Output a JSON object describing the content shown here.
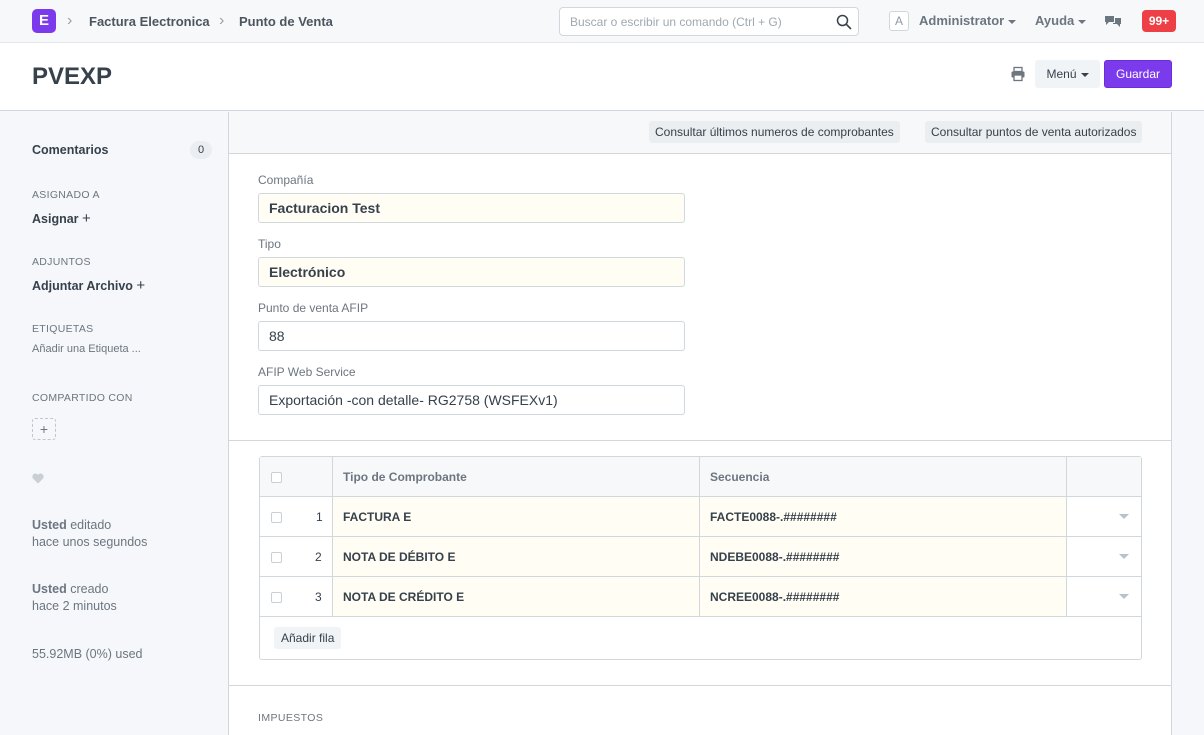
{
  "navbar": {
    "logo_letter": "E",
    "breadcrumbs": [
      "Factura Electronica",
      "Punto de Venta"
    ],
    "search_placeholder": "Buscar o escribir un comando (Ctrl + G)",
    "avatar_letter": "A",
    "user_menu": "Administrator",
    "help_menu": "Ayuda",
    "notifications": "99+"
  },
  "page": {
    "title": "PVEXP",
    "menu_label": "Menú",
    "save_label": "Guardar"
  },
  "sidebar": {
    "comments_label": "Comentarios",
    "comments_count": "0",
    "assigned_label": "ASIGNADO A",
    "assign_action": "Asignar",
    "attachments_label": "ADJUNTOS",
    "attach_action": "Adjuntar Archivo",
    "tags_label": "ETIQUETAS",
    "add_tag": "Añadir una Etiqueta ...",
    "shared_label": "COMPARTIDO CON",
    "edited_user": "Usted",
    "edited_action": " editado",
    "edited_time": "hace unos segundos",
    "created_user": "Usted",
    "created_action": " creado",
    "created_time": "hace 2 minutos",
    "storage": "55.92MB (0%) used"
  },
  "toolbar": {
    "btn_last_numbers": "Consultar últimos numeros de comprobantes",
    "btn_authorized": "Consultar puntos de venta autorizados"
  },
  "form": {
    "company_label": "Compañía",
    "company_value": "Facturacion Test",
    "type_label": "Tipo",
    "type_value": "Electrónico",
    "pos_label": "Punto de venta AFIP",
    "pos_value": "88",
    "ws_label": "AFIP Web Service",
    "ws_value": "Exportación -con detalle- RG2758 (WSFEXv1)"
  },
  "grid": {
    "columns": [
      "Tipo de Comprobante",
      "Secuencia"
    ],
    "rows": [
      {
        "idx": "1",
        "tipo": "FACTURA E",
        "secuencia": "FACTE0088-.########"
      },
      {
        "idx": "2",
        "tipo": "NOTA DE DÉBITO E",
        "secuencia": "NDEBE0088-.########"
      },
      {
        "idx": "3",
        "tipo": "NOTA DE CRÉDITO E",
        "secuencia": "NCREE0088-.########"
      }
    ],
    "add_row": "Añadir fila"
  },
  "sections": {
    "taxes": "IMPUESTOS"
  },
  "colors": {
    "primary": "#7b3bed",
    "notification": "#ee3e46",
    "mandatory_bg": "#fffdf4"
  }
}
